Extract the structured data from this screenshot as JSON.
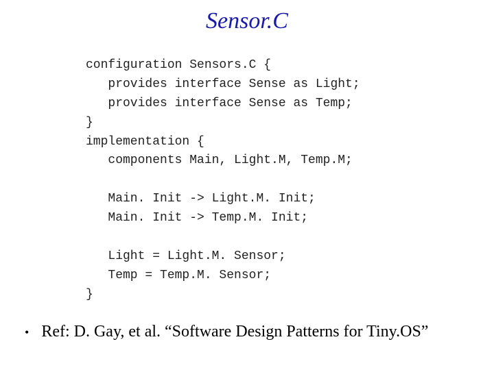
{
  "title": "Sensor.C",
  "code_lines": [
    "configuration Sensors.C {",
    "   provides interface Sense as Light;",
    "   provides interface Sense as Temp;",
    "}",
    "implementation {",
    "   components Main, Light.M, Temp.M;",
    "",
    "   Main. Init -> Light.M. Init;",
    "   Main. Init -> Temp.M. Init;",
    "",
    "   Light = Light.M. Sensor;",
    "   Temp = Temp.M. Sensor;",
    "}"
  ],
  "bullet": "•",
  "reference": "Ref: D. Gay, et al. “Software Design Patterns for Tiny.OS”"
}
